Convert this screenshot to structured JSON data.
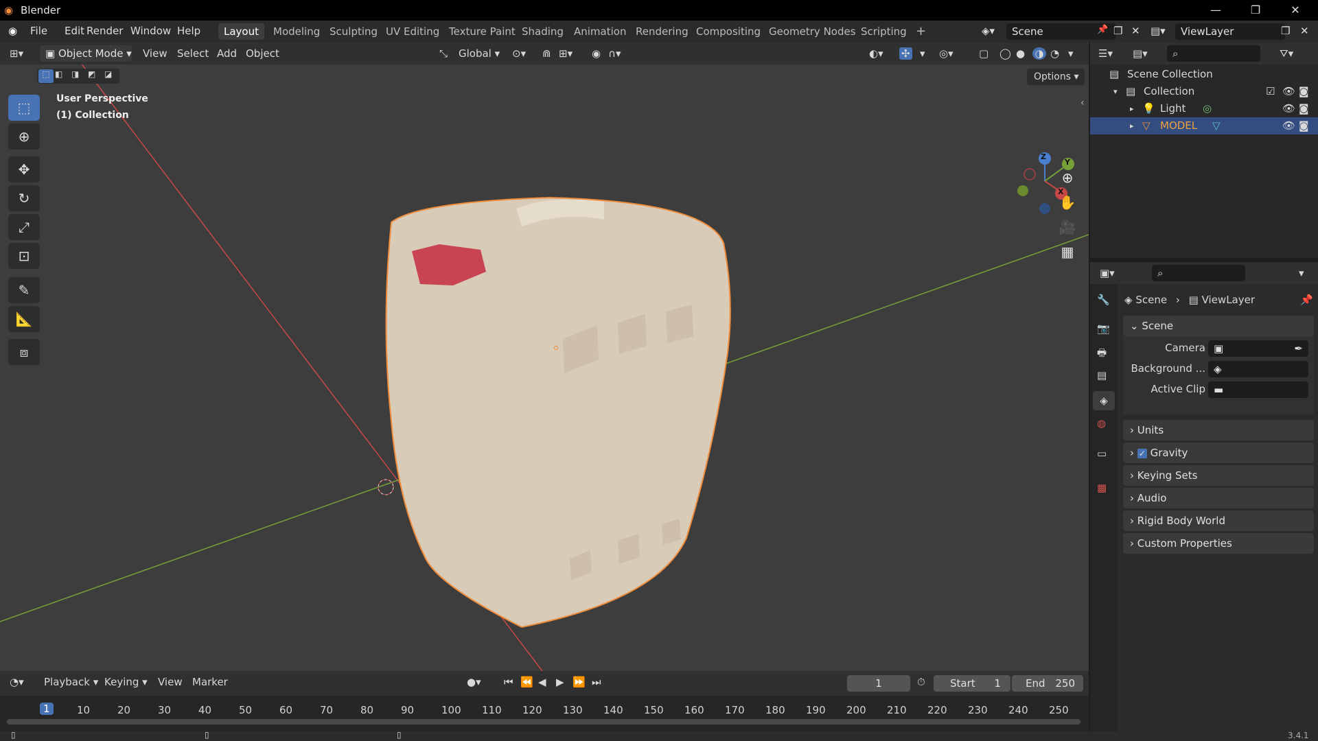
{
  "window": {
    "title": "Blender",
    "minimize": "—",
    "maximize": "❐",
    "close": "✕"
  },
  "menu": {
    "file": "File",
    "edit": "Edit",
    "render": "Render",
    "window": "Window",
    "help": "Help"
  },
  "workspaces": [
    "Layout",
    "Modeling",
    "Sculpting",
    "UV Editing",
    "Texture Paint",
    "Shading",
    "Animation",
    "Rendering",
    "Compositing",
    "Geometry Nodes",
    "Scripting"
  ],
  "workspace_add": "+",
  "scene_field": "Scene",
  "viewlayer_field": "ViewLayer",
  "viewport_header": {
    "mode": "Object Mode",
    "view": "View",
    "select": "Select",
    "add": "Add",
    "object": "Object",
    "orientation": "Global",
    "options": "Options"
  },
  "viewport": {
    "perspective": "User Perspective",
    "collection": "(1) Collection"
  },
  "gizmo": {
    "z": "Z",
    "y": "Y",
    "x": "X"
  },
  "outliner": {
    "scene_collection": "Scene Collection",
    "collection": "Collection",
    "light": "Light",
    "model": "MODEL"
  },
  "properties": {
    "breadcrumb_scene": "Scene",
    "breadcrumb_viewlayer": "ViewLayer",
    "scene_panel": "Scene",
    "camera_label": "Camera",
    "background_label": "Background ...",
    "active_clip_label": "Active Clip",
    "panels": [
      "Units",
      "Gravity",
      "Keying Sets",
      "Audio",
      "Rigid Body World",
      "Custom Properties"
    ]
  },
  "timeline": {
    "playback": "Playback",
    "keying": "Keying",
    "view": "View",
    "marker": "Marker",
    "current_frame": "1",
    "start_label": "Start",
    "start": "1",
    "end_label": "End",
    "end": "250",
    "ticks": [
      "1",
      "10",
      "20",
      "30",
      "40",
      "50",
      "60",
      "70",
      "80",
      "90",
      "100",
      "110",
      "120",
      "130",
      "140",
      "150",
      "160",
      "170",
      "180",
      "190",
      "200",
      "210",
      "220",
      "230",
      "240",
      "250"
    ]
  },
  "status": {
    "version": "3.4.1"
  },
  "colors": {
    "accent": "#4772b3",
    "selection_outline": "#f08c3a",
    "x_axis": "#c84848",
    "y_axis": "#78a038"
  }
}
